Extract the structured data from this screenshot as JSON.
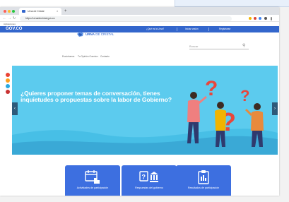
{
  "browser": {
    "tab_title": "Urna de Cristal",
    "tab_close": "×",
    "new_tab": "+",
    "nav": {
      "back": "←",
      "forward": "→",
      "reload": "↻"
    },
    "url": "https://urnadecristal.gov.co",
    "bookmarks_label": "Aplicaciones",
    "traffic_lights": [
      "#ff5f57",
      "#febc2e",
      "#28c840"
    ],
    "extension_colors": [
      "#f4b400",
      "#db4437",
      "#4285f4",
      "#555555"
    ]
  },
  "gov_header": {
    "logo": "GOV.CO",
    "links": [
      "¿Qué es la Urna?",
      "Iniciar sesión",
      "Registrarse"
    ],
    "bar_color": "#3366cc"
  },
  "site": {
    "title_bold": "URNA",
    "title_rest": " DE CRISTAL",
    "search_placeholder": "Buscar",
    "subnav": [
      "Escúchanos",
      "Tu Opinión Cuenta ▾",
      "Contacto"
    ]
  },
  "social": [
    "#ea4335",
    "#ff9f1c",
    "#2aa9e0",
    "#c83232"
  ],
  "hero": {
    "text": "¿Quieres proponer temas de conversación, tienes inquietudes o propuestas sobre la labor de Gobierno?",
    "prev_label": "‹",
    "next_label": "›",
    "background": "#47bfe6"
  },
  "cards": [
    {
      "label": "Actividades de participación",
      "icon": "calendar-hand-icon"
    },
    {
      "label": "Respuestas del gobierno",
      "icon": "question-building-icon"
    },
    {
      "label": "Resultados de participación",
      "icon": "clipboard-results-icon"
    }
  ],
  "card_color": "#3d6fe0"
}
